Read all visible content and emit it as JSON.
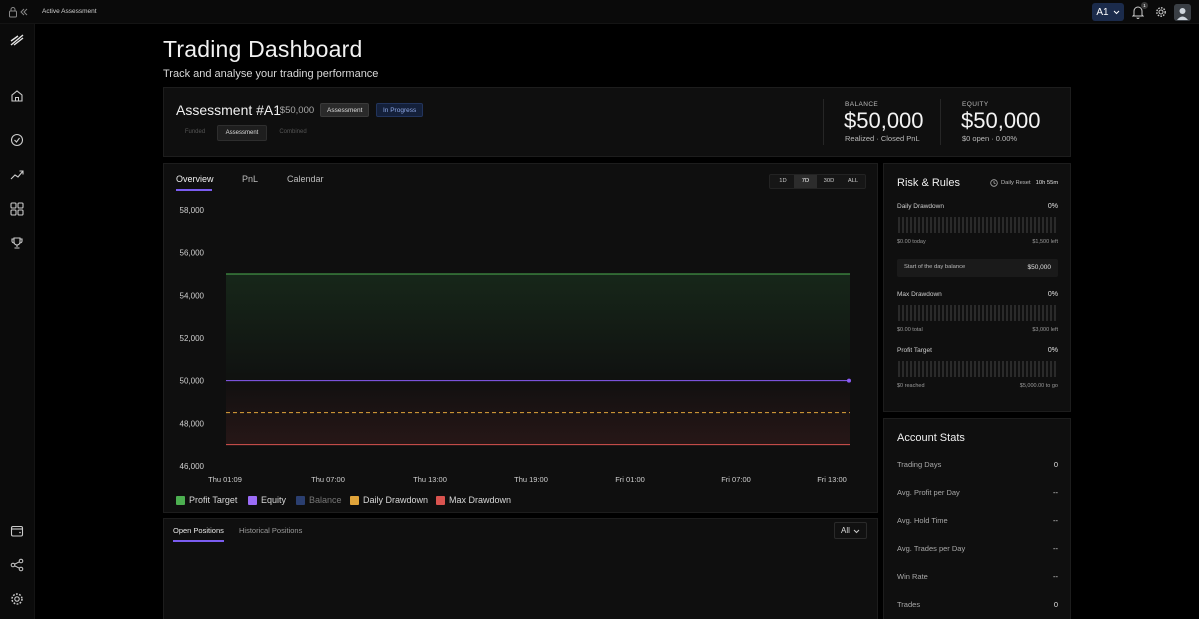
{
  "topbar": {
    "breadcrumb": "Active Assessment",
    "account_label": "A1",
    "notification_count": "1"
  },
  "sidebar": {
    "items": [
      "logo-icon",
      "home-icon",
      "compass-icon",
      "trending-up-icon",
      "grid-icon",
      "trophy-icon",
      "wallet-icon",
      "share-icon",
      "settings-icon"
    ]
  },
  "header": {
    "title": "Trading Dashboard",
    "subtitle": "Track and analyse your trading performance"
  },
  "assessment": {
    "title": "Assessment #A1",
    "amount": "· $50,000",
    "type_tag": "Assessment",
    "status_tag": "In Progress",
    "phases": [
      "Funded",
      "Assessment",
      "Combined"
    ],
    "active_phase": "Assessment",
    "balance_label": "BALANCE",
    "balance_value": "$50,000",
    "balance_sub": "Realized · Closed PnL",
    "equity_label": "EQUITY",
    "equity_value": "$50,000",
    "equity_sub": "$0 open · 0.00%"
  },
  "chart_tabs": [
    "Overview",
    "PnL",
    "Calendar"
  ],
  "range_options": [
    "1D",
    "7D",
    "30D",
    "ALL"
  ],
  "range_selected": "7D",
  "chart_data": {
    "type": "line",
    "title": "",
    "xlabel": "",
    "ylabel": "",
    "y_ticks": [
      "58,000",
      "56,000",
      "54,000",
      "52,000",
      "50,000",
      "48,000",
      "46,000"
    ],
    "x_ticks": [
      "Thu 01:09",
      "Thu 07:00",
      "Thu 13:00",
      "Thu 19:00",
      "Fri 01:00",
      "Fri 07:00",
      "Fri 13:00"
    ],
    "ylim": [
      46000,
      58000
    ],
    "series": [
      {
        "name": "Profit Target",
        "color": "#4caf50",
        "values": [
          55000,
          55000
        ]
      },
      {
        "name": "Equity",
        "color": "#8b5cf6",
        "values": [
          50000,
          50000
        ]
      },
      {
        "name": "Balance",
        "color": "#3b5ba9",
        "values": [
          50000,
          50000
        ]
      },
      {
        "name": "Daily Drawdown",
        "color": "#e0a43a",
        "values": [
          48500,
          48500
        ]
      },
      {
        "name": "Max Drawdown",
        "color": "#d9534f",
        "values": [
          47000,
          47000
        ]
      }
    ],
    "legend": [
      "Profit Target",
      "Equity",
      "Balance",
      "Daily Drawdown",
      "Max Drawdown"
    ],
    "legend_colors": [
      "#4caf50",
      "#9b6cf7",
      "#3b5ba9",
      "#e0a43a",
      "#d9534f"
    ]
  },
  "positions": {
    "tabs": [
      "Open Positions",
      "Historical Positions"
    ],
    "filter": "All"
  },
  "risk": {
    "title": "Risk & Rules",
    "reset_label": "Daily Reset",
    "reset_time": "10h 55m",
    "daily_drawdown": {
      "label": "Daily Drawdown",
      "pct": "0%",
      "left_meta": "$0.00 today",
      "right_meta": "$1,500 left"
    },
    "start_of_day": {
      "label": "Start of the day balance",
      "value": "$50,000"
    },
    "max_drawdown": {
      "label": "Max Drawdown",
      "pct": "0%",
      "left_meta": "$0.00 total",
      "right_meta": "$3,000 left"
    },
    "profit_target": {
      "label": "Profit Target",
      "pct": "0%",
      "left_meta": "$0 reached",
      "right_meta": "$5,000.00 to go"
    }
  },
  "account_stats": {
    "title": "Account Stats",
    "rows": [
      {
        "label": "Trading Days",
        "value": "0"
      },
      {
        "label": "Avg. Profit per Day",
        "value": "--"
      },
      {
        "label": "Avg. Hold Time",
        "value": "--"
      },
      {
        "label": "Avg. Trades per Day",
        "value": "--"
      },
      {
        "label": "Win Rate",
        "value": "--"
      },
      {
        "label": "Trades",
        "value": "0"
      }
    ]
  }
}
